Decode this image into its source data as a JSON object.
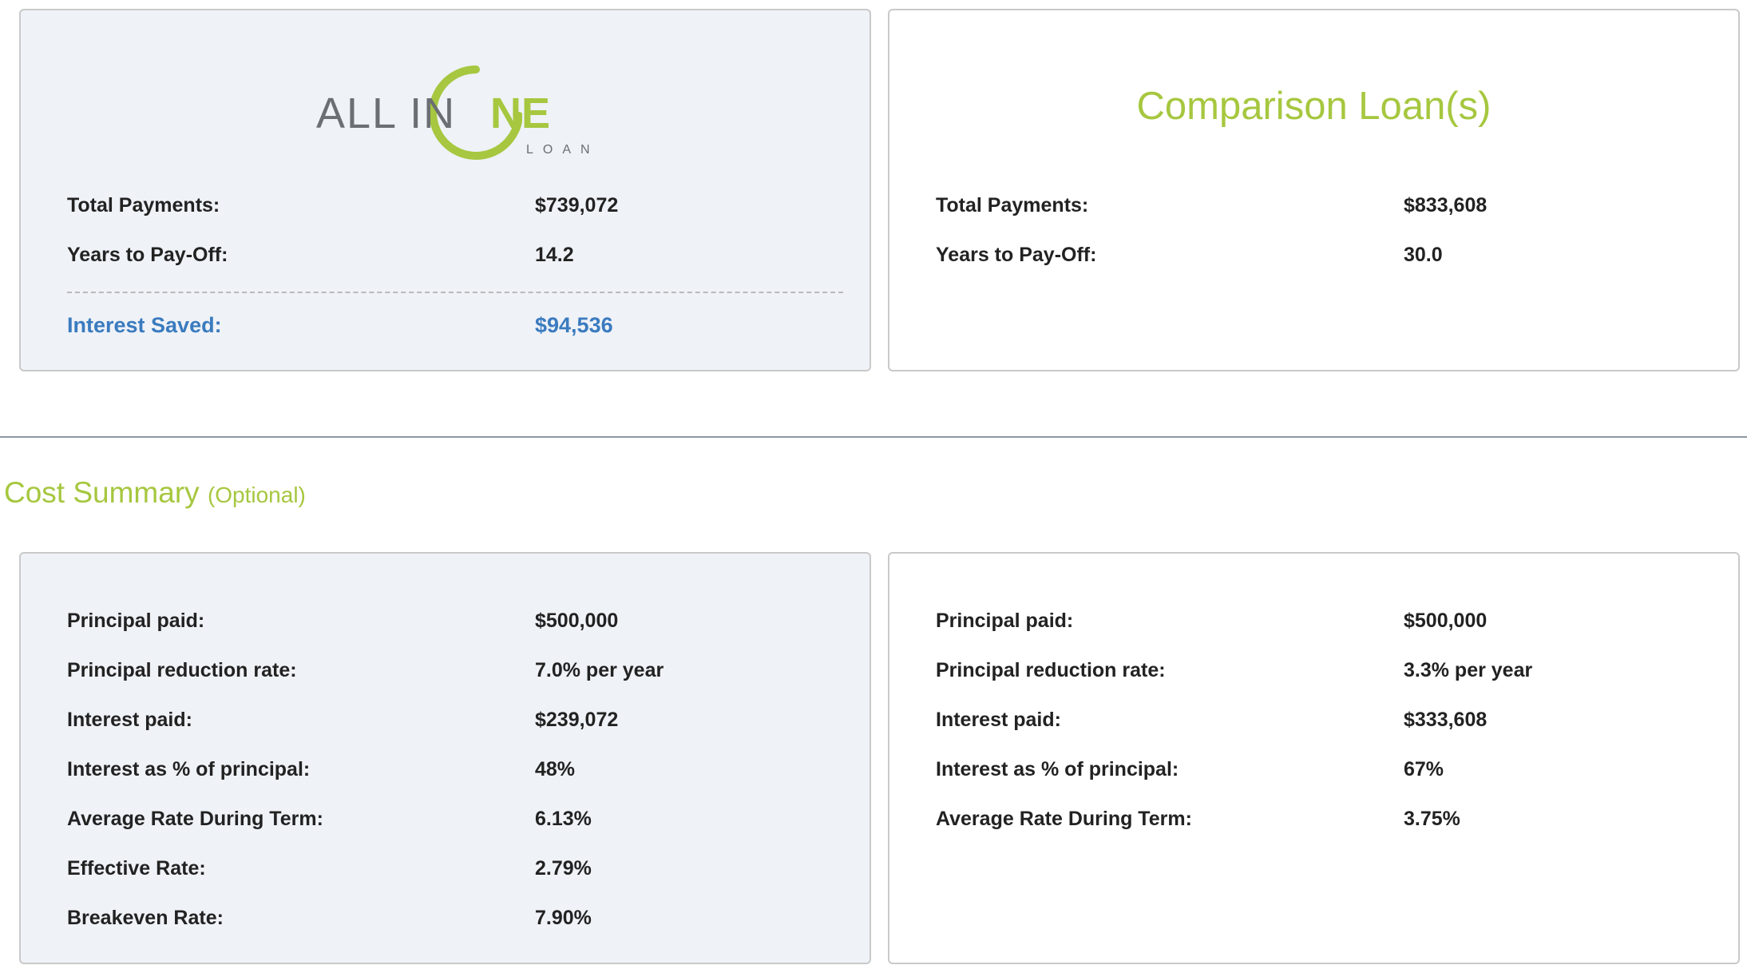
{
  "colors": {
    "accent": "#a6c73f",
    "link_blue": "#3a7bbf",
    "panel_bg": "#eff2f7"
  },
  "aio": {
    "logo": {
      "text": "ALL IN",
      "ne": "NE",
      "sub": "LOAN"
    },
    "rows": [
      {
        "label": "Total Payments:",
        "value": "$739,072"
      },
      {
        "label": "Years to Pay-Off:",
        "value": "14.2"
      }
    ],
    "saved": {
      "label": "Interest Saved:",
      "value": "$94,536"
    }
  },
  "comparison": {
    "title": "Comparison Loan(s)",
    "rows": [
      {
        "label": "Total Payments:",
        "value": "$833,608"
      },
      {
        "label": "Years to Pay-Off:",
        "value": "30.0"
      }
    ]
  },
  "cost_summary": {
    "title": "Cost Summary",
    "optional": "(Optional)",
    "aio_rows": [
      {
        "label": "Principal paid:",
        "value": "$500,000"
      },
      {
        "label": "Principal reduction rate:",
        "value": "7.0% per year"
      },
      {
        "label": "Interest paid:",
        "value": "$239,072"
      },
      {
        "label": "Interest as % of principal:",
        "value": "48%"
      },
      {
        "label": "Average Rate During Term:",
        "value": "6.13%"
      },
      {
        "label": "Effective Rate:",
        "value": "2.79%"
      },
      {
        "label": "Breakeven Rate:",
        "value": "7.90%"
      }
    ],
    "comparison_rows": [
      {
        "label": "Principal paid:",
        "value": "$500,000"
      },
      {
        "label": "Principal reduction rate:",
        "value": "3.3% per year"
      },
      {
        "label": "Interest paid:",
        "value": "$333,608"
      },
      {
        "label": "Interest as % of principal:",
        "value": "67%"
      },
      {
        "label": "Average Rate During Term:",
        "value": "3.75%"
      }
    ]
  }
}
